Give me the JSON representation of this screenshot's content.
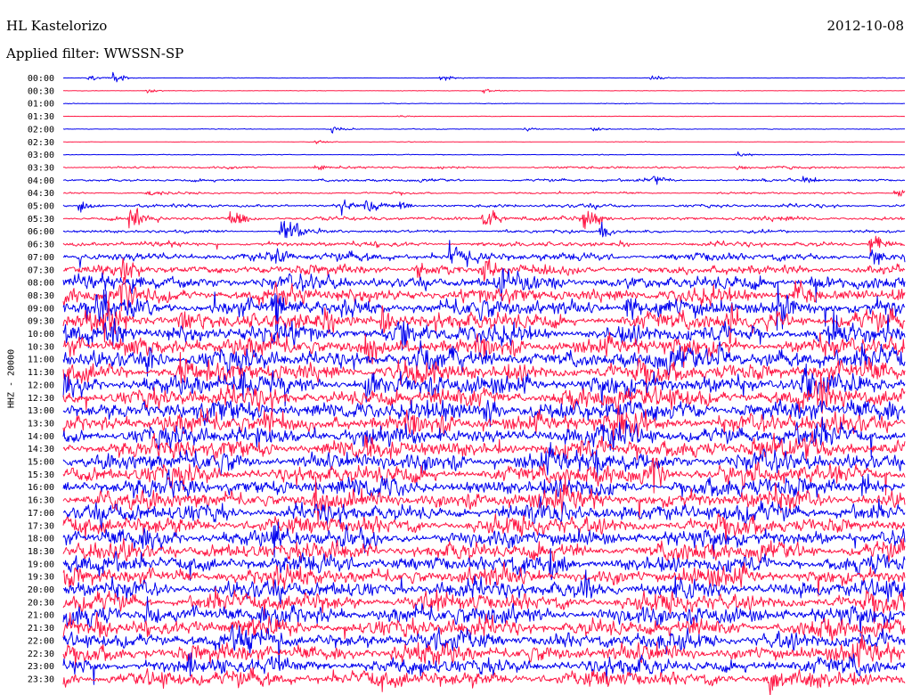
{
  "header": {
    "station": "HL Kastelorizo",
    "date": "2012-10-08",
    "filter_text": "Applied filter: WWSSN-SP"
  },
  "colors": {
    "trace_a": "#0000ee",
    "trace_b": "#ff1744",
    "background": "#ffffff"
  },
  "chart_data": {
    "type": "line",
    "ylabel": "HHZ - 20000",
    "row_labels": [
      "00:00",
      "00:30",
      "01:00",
      "01:30",
      "02:00",
      "02:30",
      "03:00",
      "03:30",
      "04:00",
      "04:30",
      "05:00",
      "05:30",
      "06:00",
      "06:30",
      "07:00",
      "07:30",
      "08:00",
      "08:30",
      "09:00",
      "09:30",
      "10:00",
      "10:30",
      "11:00",
      "11:30",
      "12:00",
      "12:30",
      "13:00",
      "13:30",
      "14:00",
      "14:30",
      "15:00",
      "15:30",
      "16:00",
      "16:30",
      "17:00",
      "17:30",
      "18:00",
      "18:30",
      "19:00",
      "19:30",
      "20:00",
      "20:30",
      "21:00",
      "21:30",
      "22:00",
      "22:30",
      "23:00",
      "23:30"
    ],
    "row_colors": [
      "trace_a",
      "trace_b"
    ],
    "rows": [
      {
        "noise": 0.03,
        "events": [
          [
            0.03,
            0.35
          ],
          [
            0.06,
            0.5
          ],
          [
            0.45,
            0.3
          ],
          [
            0.7,
            0.25
          ]
        ]
      },
      {
        "noise": 0.03,
        "events": [
          [
            0.1,
            0.25
          ],
          [
            0.5,
            0.2
          ]
        ]
      },
      {
        "noise": 0.04,
        "events": []
      },
      {
        "noise": 0.03,
        "events": [
          [
            0.4,
            0.15
          ]
        ]
      },
      {
        "noise": 0.04,
        "events": [
          [
            0.32,
            0.35
          ],
          [
            0.55,
            0.2
          ],
          [
            0.63,
            0.25
          ]
        ]
      },
      {
        "noise": 0.03,
        "events": [
          [
            0.3,
            0.2
          ]
        ]
      },
      {
        "noise": 0.05,
        "events": [
          [
            0.8,
            0.35
          ]
        ]
      },
      {
        "noise": 0.14,
        "events": [
          [
            0.3,
            0.4
          ],
          [
            0.8,
            0.3
          ]
        ]
      },
      {
        "noise": 0.16,
        "events": [
          [
            0.7,
            0.6
          ],
          [
            0.88,
            0.4
          ]
        ]
      },
      {
        "noise": 0.12,
        "events": [
          [
            0.1,
            0.45
          ],
          [
            0.99,
            0.5
          ]
        ]
      },
      {
        "noise": 0.22,
        "events": [
          [
            0.02,
            0.8
          ],
          [
            0.33,
            0.9
          ],
          [
            0.36,
            0.7
          ],
          [
            0.4,
            0.5
          ]
        ]
      },
      {
        "noise": 0.25,
        "events": [
          [
            0.08,
            1.6
          ],
          [
            0.2,
            1.2
          ],
          [
            0.5,
            1.4
          ],
          [
            0.62,
            1.6
          ]
        ]
      },
      {
        "noise": 0.2,
        "events": [
          [
            0.26,
            1.4
          ],
          [
            0.27,
            1.1
          ],
          [
            0.64,
            0.9
          ]
        ]
      },
      {
        "noise": 0.3,
        "events": [
          [
            0.96,
            1.2
          ]
        ]
      },
      {
        "noise": 0.5,
        "events": [
          [
            0.25,
            1.2
          ],
          [
            0.46,
            1.6
          ],
          [
            0.96,
            1.0
          ]
        ]
      },
      {
        "noise": 0.6,
        "events": [
          [
            0.07,
            1.8
          ],
          [
            0.42,
            1.4
          ],
          [
            0.5,
            1.8
          ]
        ]
      },
      {
        "noise": 0.85,
        "events": [
          [
            0.08,
            1.2
          ],
          [
            0.52,
            2.0
          ],
          [
            0.89,
            1.4
          ]
        ]
      },
      {
        "noise": 0.95,
        "events": [
          [
            0.07,
            1.4
          ],
          [
            0.26,
            1.2
          ],
          [
            0.87,
            1.8
          ]
        ]
      },
      {
        "noise": 1.05,
        "events": [
          [
            0.04,
            2.2
          ],
          [
            0.25,
            2.4
          ],
          [
            0.67,
            2.2
          ],
          [
            0.85,
            2.6
          ]
        ]
      },
      {
        "noise": 1.1,
        "events": [
          [
            0.05,
            2.4
          ],
          [
            0.14,
            2.0
          ],
          [
            0.38,
            2.2
          ],
          [
            0.79,
            2.4
          ]
        ]
      },
      {
        "noise": 1.15,
        "events": [
          [
            0.06,
            2.2
          ],
          [
            0.4,
            2.6
          ],
          [
            0.91,
            2.2
          ]
        ]
      },
      {
        "noise": 1.15,
        "events": [
          [
            0.07,
            2.0
          ],
          [
            0.36,
            2.4
          ]
        ]
      },
      {
        "noise": 1.2,
        "events": [
          [
            0.1,
            2.0
          ],
          [
            0.42,
            2.4
          ],
          [
            0.78,
            2.0
          ]
        ]
      },
      {
        "noise": 1.2,
        "events": [
          [
            0.14,
            2.0
          ],
          [
            0.4,
            2.2
          ]
        ]
      },
      {
        "noise": 1.25,
        "events": [
          [
            0.21,
            2.0
          ],
          [
            0.36,
            2.2
          ],
          [
            0.88,
            2.2
          ]
        ]
      },
      {
        "noise": 1.25,
        "events": [
          [
            0.9,
            2.4
          ]
        ]
      },
      {
        "noise": 1.25,
        "events": [
          [
            0.5,
            1.8
          ]
        ]
      },
      {
        "noise": 1.2,
        "events": [
          [
            0.24,
            1.8
          ],
          [
            0.66,
            2.0
          ]
        ]
      },
      {
        "noise": 1.2,
        "events": [
          [
            0.23,
            1.6
          ]
        ]
      },
      {
        "noise": 1.2,
        "events": [
          [
            0.36,
            1.6
          ],
          [
            0.82,
            1.6
          ]
        ]
      },
      {
        "noise": 1.15,
        "events": [
          [
            0.63,
            1.8
          ]
        ]
      },
      {
        "noise": 1.15,
        "events": [
          [
            0.7,
            1.6
          ]
        ]
      },
      {
        "noise": 1.15,
        "events": [
          [
            0.95,
            1.8
          ]
        ]
      },
      {
        "noise": 1.15,
        "events": [
          [
            0.3,
            1.6
          ]
        ]
      },
      {
        "noise": 1.1,
        "events": [
          [
            0.56,
            1.6
          ]
        ]
      },
      {
        "noise": 1.1,
        "events": []
      },
      {
        "noise": 1.1,
        "events": [
          [
            0.25,
            1.6
          ]
        ]
      },
      {
        "noise": 1.1,
        "events": []
      },
      {
        "noise": 1.1,
        "events": [
          [
            0.58,
            1.6
          ]
        ]
      },
      {
        "noise": 1.1,
        "events": []
      },
      {
        "noise": 1.1,
        "events": [
          [
            0.62,
            1.6
          ]
        ]
      },
      {
        "noise": 1.1,
        "events": [
          [
            0.44,
            1.6
          ]
        ]
      },
      {
        "noise": 1.15,
        "events": [
          [
            0.1,
            1.6
          ]
        ]
      },
      {
        "noise": 1.15,
        "events": [
          [
            0.04,
            1.8
          ]
        ]
      },
      {
        "noise": 1.1,
        "events": [
          [
            0.21,
            1.6
          ]
        ]
      },
      {
        "noise": 1.1,
        "events": []
      },
      {
        "noise": 1.05,
        "events": [
          [
            0.15,
            1.6
          ]
        ]
      },
      {
        "noise": 1.0,
        "events": [
          [
            0.84,
            1.4
          ]
        ]
      }
    ]
  }
}
